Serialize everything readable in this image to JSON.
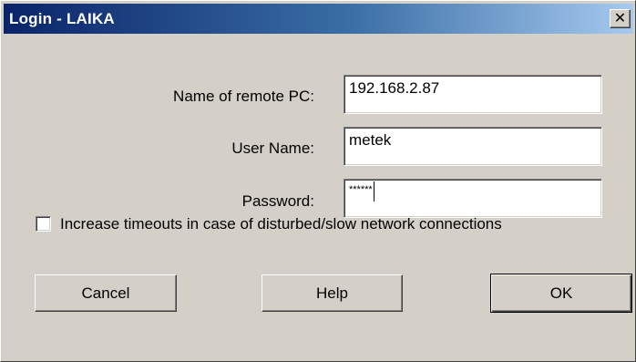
{
  "window": {
    "title": "Login - LAIKA",
    "close_label": "✕"
  },
  "form": {
    "remote_pc": {
      "label": "Name of remote PC:",
      "value": "192.168.2.87"
    },
    "user_name": {
      "label": "User Name:",
      "value": "metek"
    },
    "password": {
      "label": "Password:",
      "value": "******"
    }
  },
  "options": {
    "timeouts_label": "Increase timeouts in case of disturbed/slow network connections",
    "timeouts_checked": false
  },
  "buttons": {
    "cancel": "Cancel",
    "help": "Help",
    "ok": "OK"
  }
}
